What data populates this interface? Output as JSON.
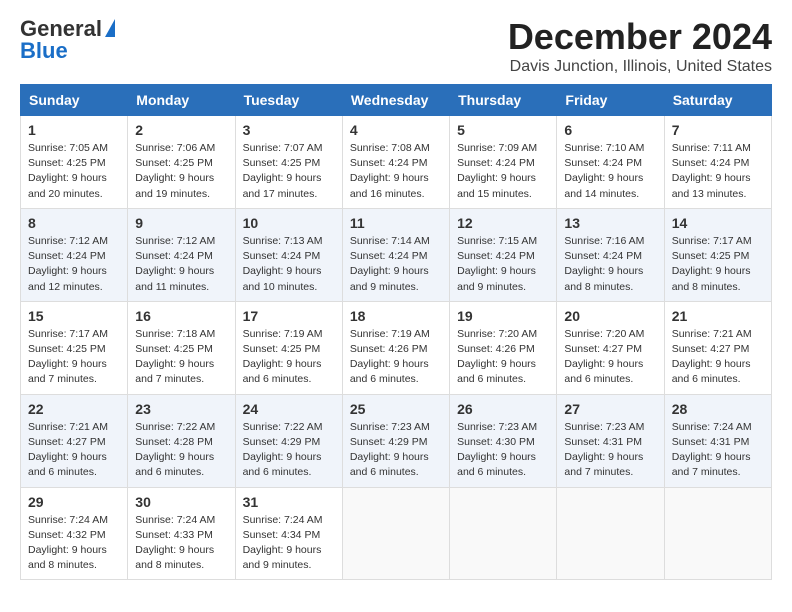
{
  "header": {
    "logo_general": "General",
    "logo_blue": "Blue",
    "month_title": "December 2024",
    "location": "Davis Junction, Illinois, United States"
  },
  "days_of_week": [
    "Sunday",
    "Monday",
    "Tuesday",
    "Wednesday",
    "Thursday",
    "Friday",
    "Saturday"
  ],
  "weeks": [
    [
      {
        "day": "1",
        "sunrise": "7:05 AM",
        "sunset": "4:25 PM",
        "daylight": "9 hours and 20 minutes."
      },
      {
        "day": "2",
        "sunrise": "7:06 AM",
        "sunset": "4:25 PM",
        "daylight": "9 hours and 19 minutes."
      },
      {
        "day": "3",
        "sunrise": "7:07 AM",
        "sunset": "4:25 PM",
        "daylight": "9 hours and 17 minutes."
      },
      {
        "day": "4",
        "sunrise": "7:08 AM",
        "sunset": "4:24 PM",
        "daylight": "9 hours and 16 minutes."
      },
      {
        "day": "5",
        "sunrise": "7:09 AM",
        "sunset": "4:24 PM",
        "daylight": "9 hours and 15 minutes."
      },
      {
        "day": "6",
        "sunrise": "7:10 AM",
        "sunset": "4:24 PM",
        "daylight": "9 hours and 14 minutes."
      },
      {
        "day": "7",
        "sunrise": "7:11 AM",
        "sunset": "4:24 PM",
        "daylight": "9 hours and 13 minutes."
      }
    ],
    [
      {
        "day": "8",
        "sunrise": "7:12 AM",
        "sunset": "4:24 PM",
        "daylight": "9 hours and 12 minutes."
      },
      {
        "day": "9",
        "sunrise": "7:12 AM",
        "sunset": "4:24 PM",
        "daylight": "9 hours and 11 minutes."
      },
      {
        "day": "10",
        "sunrise": "7:13 AM",
        "sunset": "4:24 PM",
        "daylight": "9 hours and 10 minutes."
      },
      {
        "day": "11",
        "sunrise": "7:14 AM",
        "sunset": "4:24 PM",
        "daylight": "9 hours and 9 minutes."
      },
      {
        "day": "12",
        "sunrise": "7:15 AM",
        "sunset": "4:24 PM",
        "daylight": "9 hours and 9 minutes."
      },
      {
        "day": "13",
        "sunrise": "7:16 AM",
        "sunset": "4:24 PM",
        "daylight": "9 hours and 8 minutes."
      },
      {
        "day": "14",
        "sunrise": "7:17 AM",
        "sunset": "4:25 PM",
        "daylight": "9 hours and 8 minutes."
      }
    ],
    [
      {
        "day": "15",
        "sunrise": "7:17 AM",
        "sunset": "4:25 PM",
        "daylight": "9 hours and 7 minutes."
      },
      {
        "day": "16",
        "sunrise": "7:18 AM",
        "sunset": "4:25 PM",
        "daylight": "9 hours and 7 minutes."
      },
      {
        "day": "17",
        "sunrise": "7:19 AM",
        "sunset": "4:25 PM",
        "daylight": "9 hours and 6 minutes."
      },
      {
        "day": "18",
        "sunrise": "7:19 AM",
        "sunset": "4:26 PM",
        "daylight": "9 hours and 6 minutes."
      },
      {
        "day": "19",
        "sunrise": "7:20 AM",
        "sunset": "4:26 PM",
        "daylight": "9 hours and 6 minutes."
      },
      {
        "day": "20",
        "sunrise": "7:20 AM",
        "sunset": "4:27 PM",
        "daylight": "9 hours and 6 minutes."
      },
      {
        "day": "21",
        "sunrise": "7:21 AM",
        "sunset": "4:27 PM",
        "daylight": "9 hours and 6 minutes."
      }
    ],
    [
      {
        "day": "22",
        "sunrise": "7:21 AM",
        "sunset": "4:27 PM",
        "daylight": "9 hours and 6 minutes."
      },
      {
        "day": "23",
        "sunrise": "7:22 AM",
        "sunset": "4:28 PM",
        "daylight": "9 hours and 6 minutes."
      },
      {
        "day": "24",
        "sunrise": "7:22 AM",
        "sunset": "4:29 PM",
        "daylight": "9 hours and 6 minutes."
      },
      {
        "day": "25",
        "sunrise": "7:23 AM",
        "sunset": "4:29 PM",
        "daylight": "9 hours and 6 minutes."
      },
      {
        "day": "26",
        "sunrise": "7:23 AM",
        "sunset": "4:30 PM",
        "daylight": "9 hours and 6 minutes."
      },
      {
        "day": "27",
        "sunrise": "7:23 AM",
        "sunset": "4:31 PM",
        "daylight": "9 hours and 7 minutes."
      },
      {
        "day": "28",
        "sunrise": "7:24 AM",
        "sunset": "4:31 PM",
        "daylight": "9 hours and 7 minutes."
      }
    ],
    [
      {
        "day": "29",
        "sunrise": "7:24 AM",
        "sunset": "4:32 PM",
        "daylight": "9 hours and 8 minutes."
      },
      {
        "day": "30",
        "sunrise": "7:24 AM",
        "sunset": "4:33 PM",
        "daylight": "9 hours and 8 minutes."
      },
      {
        "day": "31",
        "sunrise": "7:24 AM",
        "sunset": "4:34 PM",
        "daylight": "9 hours and 9 minutes."
      },
      null,
      null,
      null,
      null
    ]
  ],
  "labels": {
    "sunrise": "Sunrise:",
    "sunset": "Sunset:",
    "daylight": "Daylight:"
  }
}
